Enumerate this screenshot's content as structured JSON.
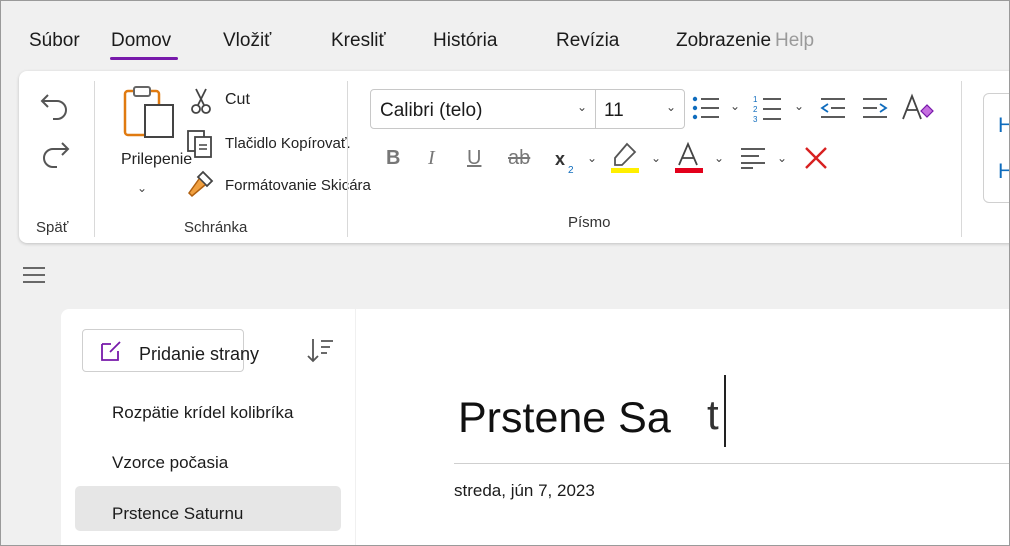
{
  "tabs": {
    "file": "Súbor",
    "home": "Domov",
    "insert": "Vložiť",
    "draw": "Kresliť",
    "history": "História",
    "review": "Revízia",
    "view": "Zobrazenie",
    "help": "Help"
  },
  "ribbon": {
    "undo_group": "Späť",
    "paste_label": "Prilepenie",
    "cut_label": "Cut",
    "copy_label": "Tlačidlo Kopírovať.",
    "format_painter_label": "Formátovanie Skicára",
    "clipboard_group": "Schránka",
    "font_name": "Calibri (telo)",
    "font_size": "11",
    "font_group": "Písmo",
    "colors": {
      "highlight": "#ffef00",
      "font_color": "#e3001b",
      "clear": "#d82020",
      "accent": "#7719aa",
      "blue": "#0f6cbd"
    }
  },
  "pages": {
    "add_page": "Pridanie strany",
    "items": [
      "Rozpätie krídel kolibríka",
      "Vzorce počasia",
      "Prstence Saturnu"
    ]
  },
  "note": {
    "title": "Prstene Sa",
    "cursor_char": "t",
    "date": "streda, jún 7, 2023"
  }
}
